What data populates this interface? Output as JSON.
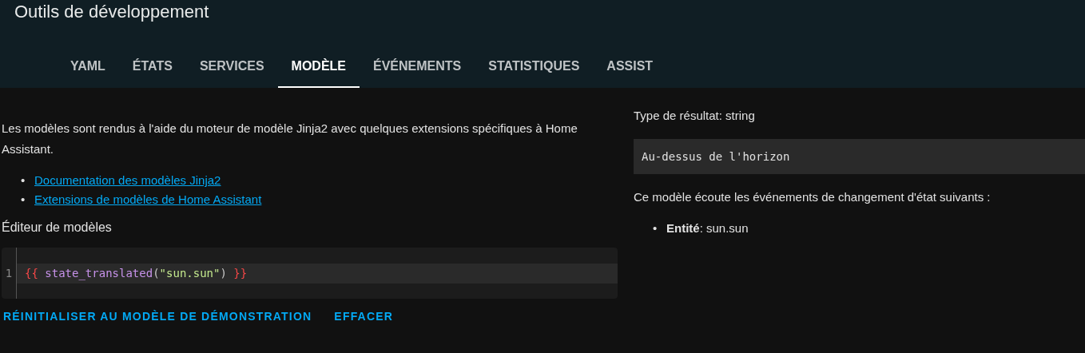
{
  "header": {
    "title": "Outils de développement"
  },
  "tabs": [
    {
      "label": "YAML",
      "selected": false
    },
    {
      "label": "ÉTATS",
      "selected": false
    },
    {
      "label": "SERVICES",
      "selected": false
    },
    {
      "label": "MODÈLE",
      "selected": true
    },
    {
      "label": "ÉVÉNEMENTS",
      "selected": false
    },
    {
      "label": "STATISTIQUES",
      "selected": false
    },
    {
      "label": "ASSIST",
      "selected": false
    }
  ],
  "intro": "Les modèles sont rendus à l'aide du moteur de modèle Jinja2 avec quelques extensions spécifiques à Home Assistant.",
  "links": [
    {
      "bullet": "•",
      "text": "Documentation des modèles Jinja2"
    },
    {
      "bullet": "•",
      "text": "Extensions de modèles de Home Assistant"
    }
  ],
  "editor": {
    "label": "Éditeur de modèles",
    "lines": [
      {
        "number": "1",
        "open": "{{ ",
        "func": "state_translated",
        "lparen": "(",
        "arg": "\"sun.sun\"",
        "rparen": ") ",
        "close": "}}"
      }
    ]
  },
  "buttons": [
    "RÉINITIALISER AU MODÈLE DE DÉMONSTRATION",
    "EFFACER"
  ],
  "result": {
    "type_label": "Type de résultat: string",
    "value": "Au-dessus de l'horizon",
    "listeners_text": "Ce modèle écoute les événements de changement d'état suivants :",
    "listeners": [
      {
        "bullet": "•",
        "text": "**Entité**: sun.sun"
      }
    ]
  }
}
